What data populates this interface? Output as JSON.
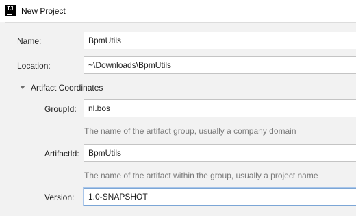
{
  "window": {
    "title": "New Project",
    "icon": "intellij-idea-icon"
  },
  "form": {
    "name": {
      "label": "Name:",
      "value": "BpmUtils"
    },
    "location": {
      "label": "Location:",
      "value": "~\\Downloads\\BpmUtils"
    },
    "artifact_section": {
      "label": "Artifact Coordinates",
      "expanded": true,
      "group_id": {
        "label": "GroupId:",
        "value": "nl.bos",
        "hint": "The name of the artifact group, usually a company domain"
      },
      "artifact_id": {
        "label": "ArtifactId:",
        "value": "BpmUtils",
        "hint": "The name of the artifact within the group, usually a project name"
      },
      "version": {
        "label": "Version:",
        "value": "1.0-SNAPSHOT",
        "focused": true
      }
    }
  },
  "colors": {
    "background": "#f2f2f2",
    "focus_border": "#7ca6d6",
    "hint_text": "#7a7a7a"
  }
}
